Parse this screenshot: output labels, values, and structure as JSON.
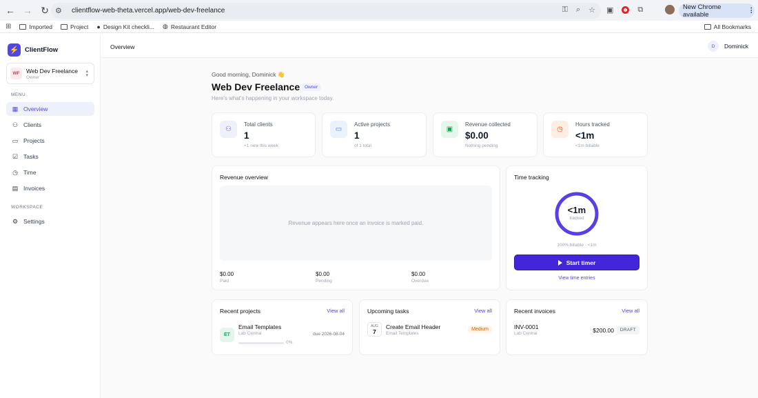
{
  "browser": {
    "url": "clientflow-web-theta.vercel.app/web-dev-freelance",
    "new_chrome": "New Chrome available",
    "bookmarks": [
      "Imported",
      "Project",
      "Design Kit checkli...",
      "Restaurant Editor"
    ],
    "all_bookmarks": "All Bookmarks"
  },
  "sidebar": {
    "brand": "ClientFlow",
    "workspace": {
      "badge": "WF",
      "name": "Web Dev Freelance",
      "role": "Owner"
    },
    "menu_label": "MENU",
    "menu": [
      {
        "label": "Overview",
        "icon": "grid-icon",
        "active": true
      },
      {
        "label": "Clients",
        "icon": "users-icon"
      },
      {
        "label": "Projects",
        "icon": "folder-icon"
      },
      {
        "label": "Tasks",
        "icon": "check-square-icon"
      },
      {
        "label": "Time",
        "icon": "clock-icon"
      },
      {
        "label": "Invoices",
        "icon": "file-icon"
      }
    ],
    "workspace_label": "WORKSPACE",
    "settings": "Settings"
  },
  "header": {
    "crumb": "Overview",
    "user_initial": "D",
    "user_name": "Dominick"
  },
  "hero": {
    "greeting": "Good morning, Dominick 👋",
    "title": "Web Dev Freelance",
    "badge": "Owner",
    "subtitle": "Here's what's happening in your workspace today."
  },
  "stats": [
    {
      "label": "Total clients",
      "value": "1",
      "sub": "+1 new this week",
      "icon": "users-icon",
      "color": "#6366f1",
      "bg": "#eef0fc"
    },
    {
      "label": "Active projects",
      "value": "1",
      "sub": "of 1 total",
      "icon": "folder-icon",
      "color": "#3b82f6",
      "bg": "#eaf2fe"
    },
    {
      "label": "Revenue collected",
      "value": "$0.00",
      "sub": "Nothing pending",
      "icon": "wallet-icon",
      "color": "#16a34a",
      "bg": "#e6f6ec"
    },
    {
      "label": "Hours tracked",
      "value": "<1m",
      "sub": "<1m billable",
      "icon": "clock-icon",
      "color": "#ea580c",
      "bg": "#fdeee3"
    }
  ],
  "revenue": {
    "title": "Revenue overview",
    "empty": "Revenue appears here once an invoice is marked paid.",
    "totals": [
      {
        "value": "$0.00",
        "label": "Paid"
      },
      {
        "value": "$0.00",
        "label": "Pending"
      },
      {
        "value": "$0.00",
        "label": "Overdue"
      }
    ]
  },
  "time": {
    "title": "Time tracking",
    "ring_value": "<1m",
    "ring_caption": "tracked",
    "billable": "100% billable · <1m",
    "start": "Start timer",
    "view": "View time entries"
  },
  "projects": {
    "title": "Recent projects",
    "view_all": "View all",
    "item": {
      "badge": "ET",
      "name": "Email Templates",
      "client": "Lab Central",
      "progress": 0,
      "pct": "0%",
      "due": "due 2026-08-04"
    }
  },
  "tasks": {
    "title": "Upcoming tasks",
    "view_all": "View all",
    "item": {
      "month": "AUG",
      "day": "7",
      "name": "Create Email Header",
      "project": "Email Templates",
      "priority": "Medium"
    }
  },
  "invoices": {
    "title": "Recent invoices",
    "view_all": "View all",
    "item": {
      "number": "INV-0001",
      "client": "Lab Central",
      "amount": "$200.00",
      "status": "DRAFT"
    }
  }
}
